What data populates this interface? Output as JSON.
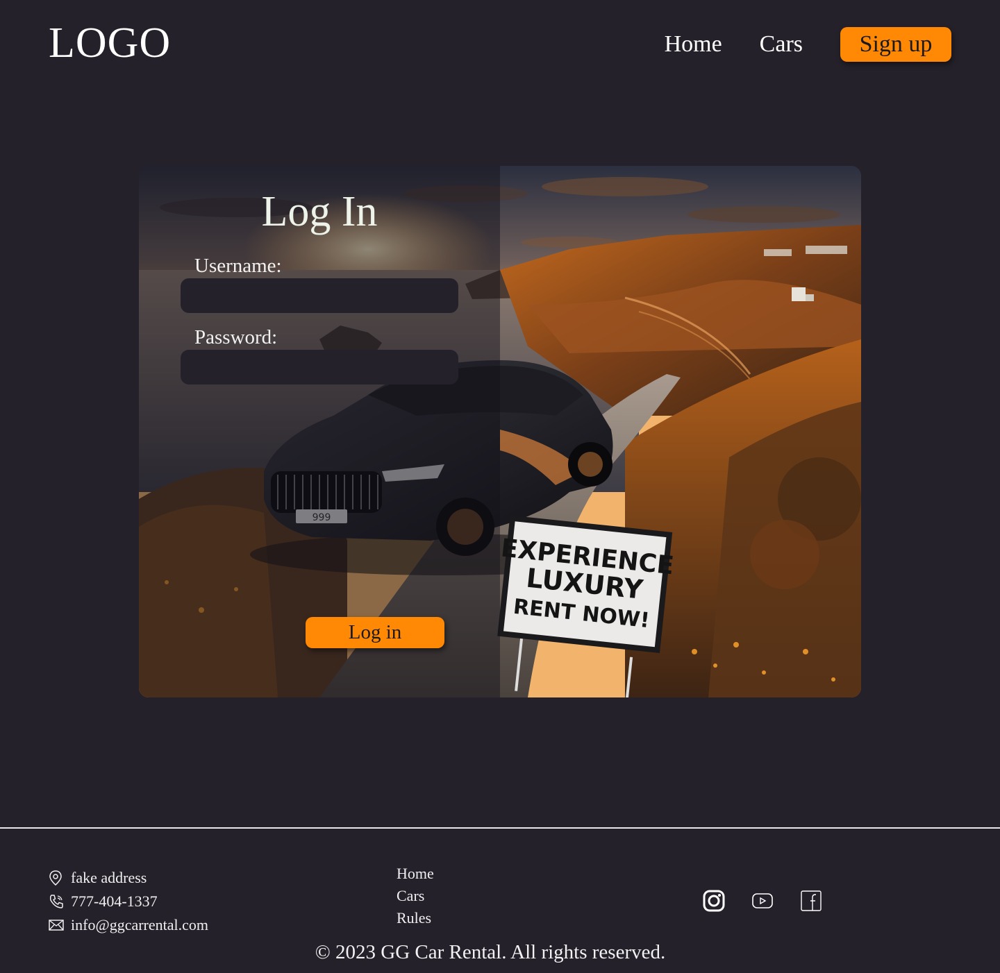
{
  "header": {
    "logo": "LOGO",
    "nav": {
      "home": "Home",
      "cars": "Cars",
      "signup": "Sign up"
    }
  },
  "login": {
    "title": "Log In",
    "username_label": "Username:",
    "username_value": "",
    "password_label": "Password:",
    "password_value": "",
    "submit_label": "Log in",
    "sign": {
      "line1": "EXPERIENCE",
      "line2": "LUXURY",
      "line3": "RENT NOW!"
    },
    "plate": "999"
  },
  "footer": {
    "address": "fake address",
    "phone": "777-404-1337",
    "email": "info@ggcarrental.com",
    "links": {
      "home": "Home",
      "cars": "Cars",
      "rules": "Rules"
    },
    "social": [
      "instagram-icon",
      "youtube-icon",
      "facebook-icon"
    ],
    "copyright": "© 2023 GG Car Rental. All rights reserved."
  },
  "colors": {
    "background": "#24212a",
    "accent": "#ff8904",
    "input_bg": "#24212a"
  }
}
